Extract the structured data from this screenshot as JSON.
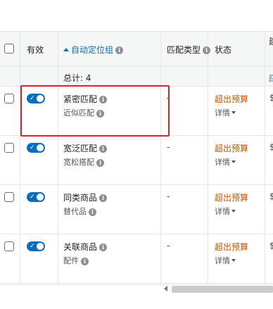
{
  "header": {
    "enabled_label": "有效",
    "auto_targeting_group_label": "自动定位组",
    "match_type_label": "匹配类型",
    "status_label": "状态",
    "next_column_label": "建"
  },
  "total": {
    "label": "总计: 4",
    "next_column_fragment": "应"
  },
  "rows": [
    {
      "name": "紧密匹配",
      "sub": "近似匹配",
      "match_type": "-",
      "status": "超出预算",
      "details": "详情",
      "next": "$"
    },
    {
      "name": "宽泛匹配",
      "sub": "宽松搭配",
      "match_type": "-",
      "status": "超出预算",
      "details": "详情",
      "next": "$"
    },
    {
      "name": "同类商品",
      "sub": "替代品",
      "match_type": "-",
      "status": "超出预算",
      "details": "详情",
      "next": "$"
    },
    {
      "name": "关联商品",
      "sub": "配件",
      "match_type": "-",
      "status": "超出预算",
      "details": "详情",
      "next": "$"
    }
  ],
  "icons": {
    "info": "info-icon",
    "sort": "sort-ascending-icon",
    "toggle_check": "check-icon",
    "caret": "caret-down-icon",
    "scroll_left": "scroll-left-arrow-icon"
  },
  "colors": {
    "accent_blue": "#0a6ebd",
    "status_orange": "#c45500",
    "highlight_red": "#e41e26",
    "header_bg": "#f5f6f6"
  },
  "symbols": {
    "info_glyph": "i",
    "check_glyph": "✓"
  }
}
